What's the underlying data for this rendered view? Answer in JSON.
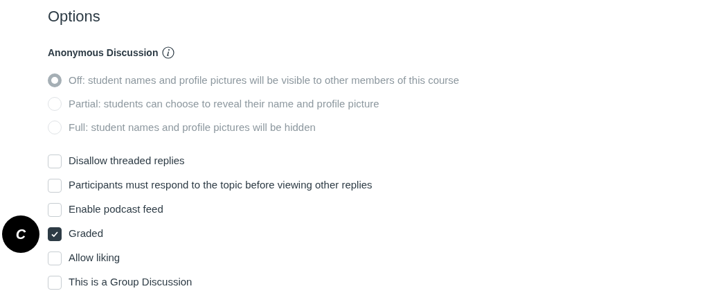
{
  "heading": "Options",
  "anonymous": {
    "label": "Anonymous Discussion",
    "disabled": true,
    "options": [
      {
        "label": "Off: student names and profile pictures will be visible to other members of this course",
        "selected": true
      },
      {
        "label": "Partial: students can choose to reveal their name and profile picture",
        "selected": false
      },
      {
        "label": "Full: student names and profile pictures will be hidden",
        "selected": false
      }
    ]
  },
  "checkboxes": [
    {
      "label": "Disallow threaded replies",
      "checked": false
    },
    {
      "label": "Participants must respond to the topic before viewing other replies",
      "checked": false
    },
    {
      "label": "Enable podcast feed",
      "checked": false
    },
    {
      "label": "Graded",
      "checked": true,
      "callout": "C"
    },
    {
      "label": "Allow liking",
      "checked": false
    },
    {
      "label": "This is a Group Discussion",
      "checked": false
    }
  ]
}
